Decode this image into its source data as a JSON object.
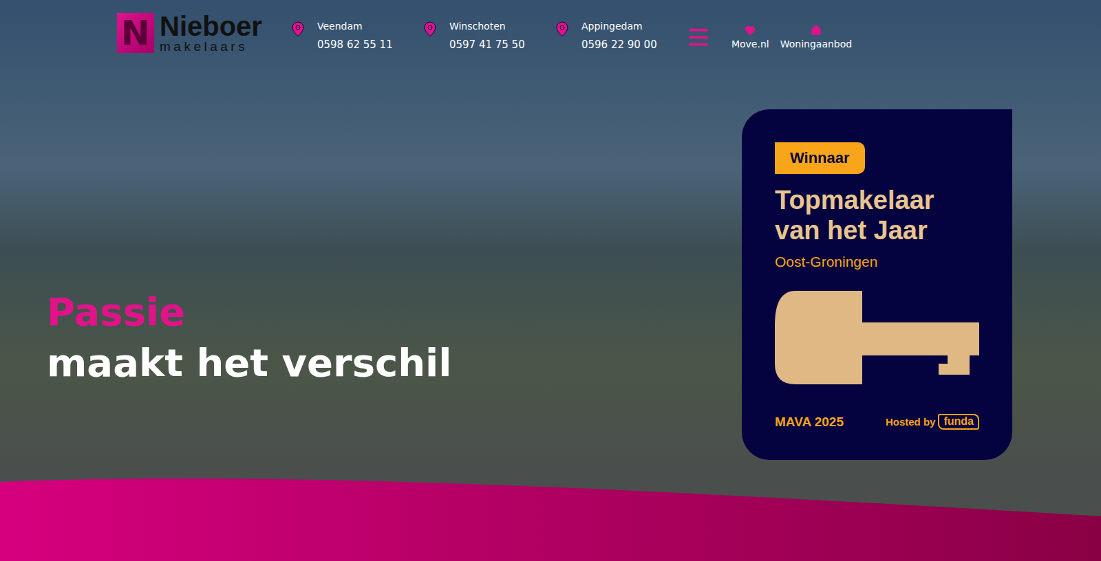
{
  "header": {
    "logo": {
      "mark": "N",
      "name": "Nieboer",
      "tagline": "makelaars"
    },
    "locations": [
      {
        "city": "Veendam",
        "phone": "0598 62 55 11"
      },
      {
        "city": "Winschoten",
        "phone": "0597 41 75 50"
      },
      {
        "city": "Appingedam",
        "phone": "0596 22 90 00"
      }
    ],
    "links": [
      {
        "label": "Move.nl",
        "kind": "heart"
      },
      {
        "label": "Woningaanbod",
        "kind": "house"
      }
    ]
  },
  "hero": {
    "headline_accent": "Passie",
    "headline": "maakt het verschil"
  },
  "badge": {
    "tag": "Winnaar",
    "title_lines": [
      "Topmakelaar",
      "van het Jaar"
    ],
    "region": "Oost-Groningen",
    "event": "MAVA 2025",
    "host_label": "Hosted by",
    "host": "funda"
  }
}
